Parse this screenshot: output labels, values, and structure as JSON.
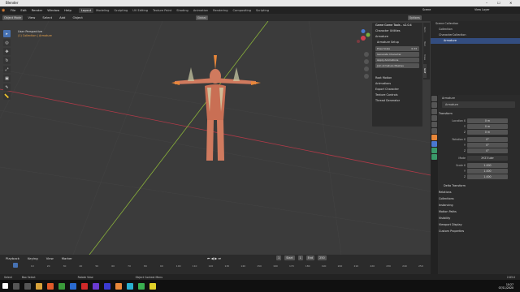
{
  "window": {
    "title": "Blender",
    "controls": [
      "–",
      "☐",
      "✕"
    ]
  },
  "menu": {
    "items": [
      "File",
      "Edit",
      "Render",
      "Window",
      "Help"
    ]
  },
  "workspaces": {
    "tabs": [
      "Layout",
      "Modeling",
      "Sculpting",
      "UV Editing",
      "Texture Paint",
      "Shading",
      "Animation",
      "Rendering",
      "Compositing",
      "Scripting"
    ],
    "active": "Layout"
  },
  "scene": {
    "label": "Scene",
    "view_layer": "View Layer"
  },
  "viewport_header": {
    "mode": "Object Mode",
    "view": "View",
    "select": "Select",
    "add": "Add",
    "object": "Object",
    "orientation": "Global",
    "options": "Options"
  },
  "viewport": {
    "title": "User Perspective",
    "collection": "(1) Collection | Armature"
  },
  "npanel": {
    "tabs": [
      "Item",
      "Tool",
      "View",
      "GGT"
    ],
    "header": "Game Game Tools - v2.0.4",
    "sections": [
      "Character Utilities",
      "Armature"
    ],
    "armature_setup": "Armature Setup",
    "pose_scale": {
      "label": "Pose Scale",
      "value": "0.33"
    },
    "buttons": [
      "Generate Character",
      "Apply Animations",
      "Join Armature Meshes"
    ],
    "sub_sections": [
      "Root Motion",
      "Animations",
      "Export Character",
      "Texture Controls",
      "Thread Generator"
    ]
  },
  "outliner": {
    "header": "Scene Collection",
    "rows": [
      "Scene Collection",
      "Collection",
      "CharacterCollection",
      "Armature"
    ]
  },
  "properties": {
    "object_name": "Armature",
    "data_name": "Armature",
    "transform_label": "Transform",
    "location": {
      "label": "Location X",
      "x": "0 m",
      "y": "0 m",
      "z": "0 m"
    },
    "rotation": {
      "label": "Rotation X",
      "x": "0°",
      "y": "0°",
      "z": "0°"
    },
    "mode": {
      "label": "Mode",
      "value": "XYZ Euler"
    },
    "scale": {
      "label": "Scale X",
      "x": "1.000",
      "y": "1.000",
      "z": "1.000"
    },
    "axis_labels": [
      "Y",
      "Z"
    ],
    "sections": [
      "Delta Transform",
      "Relations",
      "Collections",
      "Instancing",
      "Motion Paths",
      "Visibility",
      "Viewport Display",
      "Custom Properties"
    ]
  },
  "timeline": {
    "menus": [
      "Playback",
      "Keying",
      "View",
      "Marker"
    ],
    "current_frame": "1",
    "start_label": "Start",
    "start": "1",
    "end_label": "End",
    "end": "250",
    "ticks": [
      "1",
      "10",
      "20",
      "30",
      "40",
      "50",
      "60",
      "70",
      "80",
      "90",
      "100",
      "110",
      "120",
      "130",
      "140",
      "150",
      "160",
      "170",
      "180",
      "190",
      "200",
      "210",
      "220",
      "230",
      "240",
      "250"
    ]
  },
  "statusbar": {
    "items": [
      "Select",
      "Box Select",
      "Rotate View",
      "Object Context Menu"
    ],
    "version": "2.83.0"
  },
  "taskbar": {
    "time": "10:27",
    "date": "07/11/2020"
  },
  "colors": {
    "accent": "#4772b3",
    "character": "#d07a5e",
    "orange": "#e8873a",
    "grid_x": "#b03a48",
    "grid_y": "#8ab23a"
  }
}
